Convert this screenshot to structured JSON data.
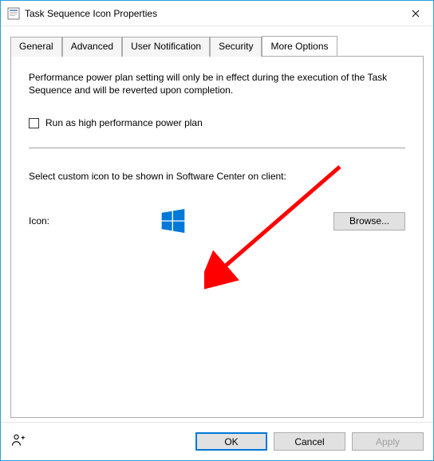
{
  "window": {
    "title": "Task Sequence Icon Properties"
  },
  "tabs": {
    "general": "General",
    "advanced": "Advanced",
    "user_notification": "User Notification",
    "security": "Security",
    "more_options": "More Options",
    "active": "more_options"
  },
  "more_options_panel": {
    "description": "Performance power plan setting will only be in effect during the execution of the Task Sequence and will be reverted upon completion.",
    "checkbox_label": "Run as high performance power plan",
    "checkbox_checked": false,
    "icon_section_label": "Select custom icon to be shown in Software Center on client:",
    "icon_label": "Icon:",
    "browse_label": "Browse...",
    "selected_icon": "windows-logo"
  },
  "footer": {
    "ok": "OK",
    "cancel": "Cancel",
    "apply": "Apply",
    "apply_enabled": false
  },
  "annotation": {
    "arrow_color": "#ff0000"
  }
}
